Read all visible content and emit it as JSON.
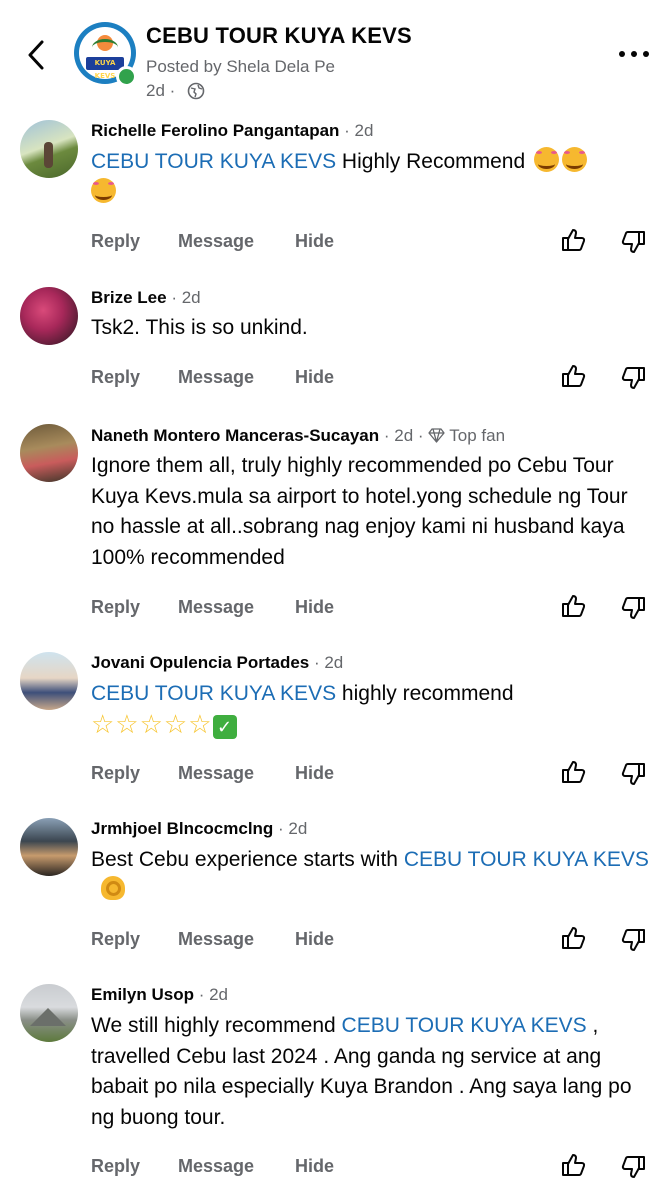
{
  "header": {
    "page_name": "CEBU TOUR KUYA KEVS",
    "posted_by": "Posted by Shela Dela Pe",
    "time": "2d ·",
    "logo_text": "KUYA KEVS"
  },
  "actions": {
    "reply": "Reply",
    "message": "Message",
    "hide": "Hide"
  },
  "comments": [
    {
      "name": "Richelle Ferolino Pangantapan",
      "meta": " · 2d",
      "mention": "CEBU TOUR KUYA KEVS",
      "text": " Highly Recommend "
    },
    {
      "name": "Brize Lee",
      "meta": " · 2d",
      "text": "Tsk2. This is so unkind."
    },
    {
      "name": "Naneth Montero Manceras-Sucayan",
      "meta": " · 2d · ",
      "badge": "Top fan",
      "text": "Ignore them all, truly highly recommended po Cebu Tour Kuya Kevs.mula sa airport to hotel.yong schedule ng Tour no hassle at all..sobrang nag enjoy kami ni husband kaya 100% recommended"
    },
    {
      "name": "Jovani Opulencia Portades",
      "meta": " · 2d",
      "mention": "CEBU TOUR KUYA KEVS",
      "text": "  highly recommend",
      "stars": "☆☆☆☆☆"
    },
    {
      "name": "Jrmhjoel Blncocmclng",
      "meta": " · 2d",
      "text_before": "Best Cebu experience starts with ",
      "mention": "CEBU TOUR KUYA KEVS"
    },
    {
      "name": "Emilyn Usop",
      "meta": " · 2d",
      "text_before": "We still highly recommend ",
      "mention": "CEBU TOUR KUYA KEVS",
      "text": " , travelled Cebu last 2024 . Ang ganda ng service at ang babait po nila especially Kuya Brandon . Ang saya lang po ng buong tour."
    }
  ],
  "colors": {
    "mention": "#1c6db5",
    "meta": "#65676b",
    "online": "#31a24c"
  }
}
